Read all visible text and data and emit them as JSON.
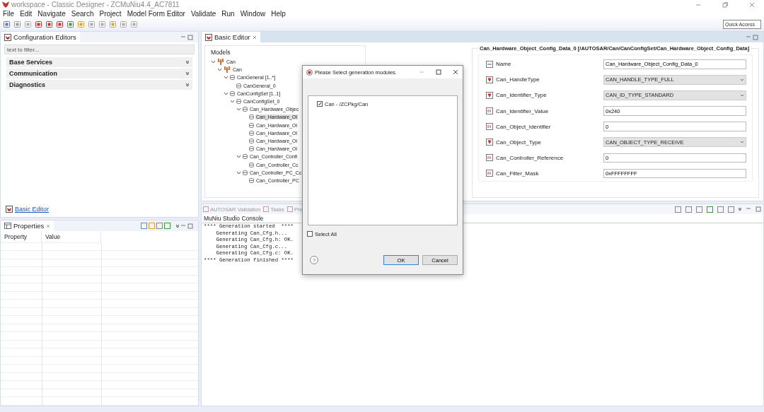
{
  "window": {
    "title": "workspace - Classic Designer - ZCMuNiu4.4_AC7811"
  },
  "menu": [
    "File",
    "Edit",
    "Navigate",
    "Search",
    "Project",
    "Model Form Editor",
    "Validate",
    "Run",
    "Window",
    "Help"
  ],
  "quick_access": {
    "placeholder": "Quick Access"
  },
  "config_editors": {
    "title": "Configuration Editors",
    "filter": {
      "placeholder": "text to filter..."
    },
    "sections": [
      {
        "label": "Base Services",
        "expanded": false
      },
      {
        "label": "Communication",
        "expanded": false
      },
      {
        "label": "Diagnostics",
        "expanded": false
      }
    ],
    "link": "Basic Editor"
  },
  "properties": {
    "title": "Properties",
    "columns": [
      "Property",
      "Value"
    ]
  },
  "editor": {
    "tab": "Basic Editor",
    "tree_title": "Models",
    "tree": [
      {
        "label": "Can",
        "kind": "module",
        "expanded": true,
        "selected": false,
        "children": [
          {
            "label": "Can",
            "kind": "module",
            "expanded": true,
            "selected": false,
            "children": [
              {
                "label": "CanGeneral [1..*]",
                "kind": "container",
                "expanded": true,
                "selected": false,
                "children": [
                  {
                    "label": "CanGeneral_0",
                    "kind": "container",
                    "selected": false
                  }
                ]
              },
              {
                "label": "CanConfigSet [1..1]",
                "kind": "container",
                "expanded": true,
                "selected": false,
                "children": [
                  {
                    "label": "CanConfigSet_0",
                    "kind": "container",
                    "expanded": true,
                    "selected": false,
                    "children": [
                      {
                        "label": "Can_Hardware_Objec",
                        "kind": "container",
                        "expanded": true,
                        "selected": false,
                        "children": [
                          {
                            "label": "Can_Hardware_Ol",
                            "kind": "container",
                            "selected": true
                          },
                          {
                            "label": "Can_Hardware_Ol",
                            "kind": "container",
                            "selected": false
                          },
                          {
                            "label": "Can_Hardware_Ol",
                            "kind": "container",
                            "selected": false
                          },
                          {
                            "label": "Can_Hardware_Ol",
                            "kind": "container",
                            "selected": false
                          },
                          {
                            "label": "Can_Hardware_Ol",
                            "kind": "container",
                            "selected": false
                          }
                        ]
                      },
                      {
                        "label": "Can_Controller_Confi",
                        "kind": "container",
                        "expanded": true,
                        "selected": false,
                        "children": [
                          {
                            "label": "Can_Controller_Cc",
                            "kind": "container",
                            "selected": false
                          }
                        ]
                      },
                      {
                        "label": "Can_Controller_PC_Cc",
                        "kind": "container",
                        "expanded": true,
                        "selected": false,
                        "children": [
                          {
                            "label": "Can_Controller_PC",
                            "kind": "container",
                            "selected": false
                          }
                        ]
                      }
                    ]
                  }
                ]
              }
            ]
          }
        ]
      }
    ],
    "form_title": "Can_Hardware_Object_Config_Data_0 [/AUTOSAR/Can/CanConfigSet/Can_Hardware_Object_Config_Data]",
    "fields": [
      {
        "label": "Name",
        "kind": "text",
        "value": "Can_Hardware_Object_Config_Data_0"
      },
      {
        "label": "Can_HandleType",
        "kind": "select",
        "value": "CAN_HANDLE_TYPE_FULL"
      },
      {
        "label": "Can_Identifier_Type",
        "kind": "select",
        "value": "CAN_ID_TYPE_STANDARD"
      },
      {
        "label": "Can_Identifier_Value",
        "kind": "text",
        "value": "0x240"
      },
      {
        "label": "Can_Object_Identifier",
        "kind": "text",
        "value": "0"
      },
      {
        "label": "Can_Object_Type",
        "kind": "select",
        "value": "CAN_OBJECT_TYPE_RECEIVE"
      },
      {
        "label": "Can_Controller_Reference",
        "kind": "text",
        "value": "0"
      },
      {
        "label": "Can_Filter_Mask",
        "kind": "text",
        "value": "0xFFFFFFFF"
      }
    ]
  },
  "console": {
    "tabs": [
      {
        "label": "AUTOSAR Validation",
        "selected": false
      },
      {
        "label": "Tasks",
        "selected": false
      },
      {
        "label": "Pro",
        "selected": false
      }
    ],
    "title": "MuNiu Studio Console",
    "lines": [
      "**** Generation started  ****",
      "    Generating Can_Cfg.h...",
      "    Generating Can_Cfg.h: OK.",
      "    Generating Can_Cfg.c...",
      "    Generating Can_Cfg.c: OK.",
      "**** Generation finished ****"
    ]
  },
  "dialog": {
    "title": "Please Select generation modules.",
    "modules": [
      {
        "label": "Can - /ZCPkg/Can",
        "checked": true
      }
    ],
    "select_all": {
      "label": "Select All",
      "checked": false
    },
    "help": "?",
    "buttons": [
      "OK",
      "Cancel"
    ]
  }
}
